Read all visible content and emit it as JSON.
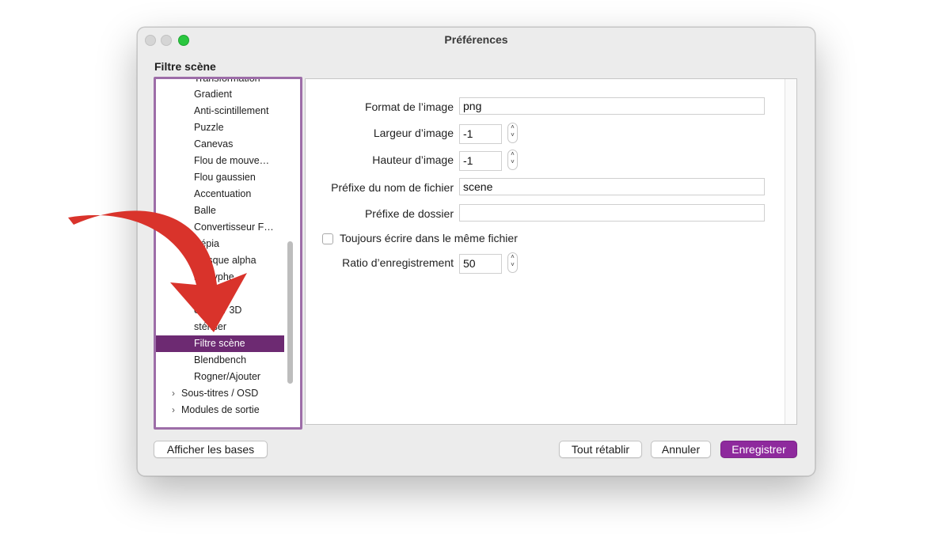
{
  "window": {
    "title": "Préférences"
  },
  "section_title": "Filtre scène",
  "tree": {
    "clipped_item": "Transformation",
    "items": [
      "Gradient",
      "Anti-scintillement",
      "Puzzle",
      "Canevas",
      "Flou de mouve…",
      "Flou gaussien",
      "Accentuation",
      "Balle",
      "Convertisseur F…",
      "Sépia",
      "Masque alpha",
      "Anaglyphe",
      "",
      "Débruiteur 3D",
      "Postériser",
      "Filtre scène",
      "Blendbench",
      "Rogner/Ajouter"
    ],
    "visible_items": [
      "Gradient",
      "Anti-scintillement",
      "Puzzle",
      "Canevas",
      "Flou de mouve…",
      "Flou gaussien",
      "Accentuation",
      "Balle",
      "Convertisseur F…",
      "Sépia",
      "Masque alpha",
      "naglyphe",
      "",
      "enoiser 3D",
      "stériser",
      "Filtre scène",
      "Blendbench",
      "Rogner/Ajouter"
    ],
    "selected": "Filtre scène",
    "categories": [
      "Sous-titres / OSD",
      "Modules de sortie"
    ]
  },
  "form": {
    "format_label": "Format de l’image",
    "format_value": "png",
    "width_label": "Largeur d’image",
    "width_value": "-1",
    "height_label": "Hauteur d’image",
    "height_value": "-1",
    "prefix_label": "Préfixe du nom de fichier",
    "prefix_value": "scene",
    "folder_label": "Préfixe de dossier",
    "folder_value": "",
    "same_file_label": "Toujours écrire dans le même fichier",
    "same_file_checked": false,
    "ratio_label": "Ratio d’enregistrement",
    "ratio_value": "50"
  },
  "buttons": {
    "show_basics": "Afficher les bases",
    "reset_all": "Tout rétablir",
    "cancel": "Annuler",
    "save": "Enregistrer"
  },
  "colors": {
    "accent": "#8e2a9d",
    "selection": "#6d2a72",
    "arrow": "#d9332b",
    "highlight_border": "#9d6da8"
  }
}
